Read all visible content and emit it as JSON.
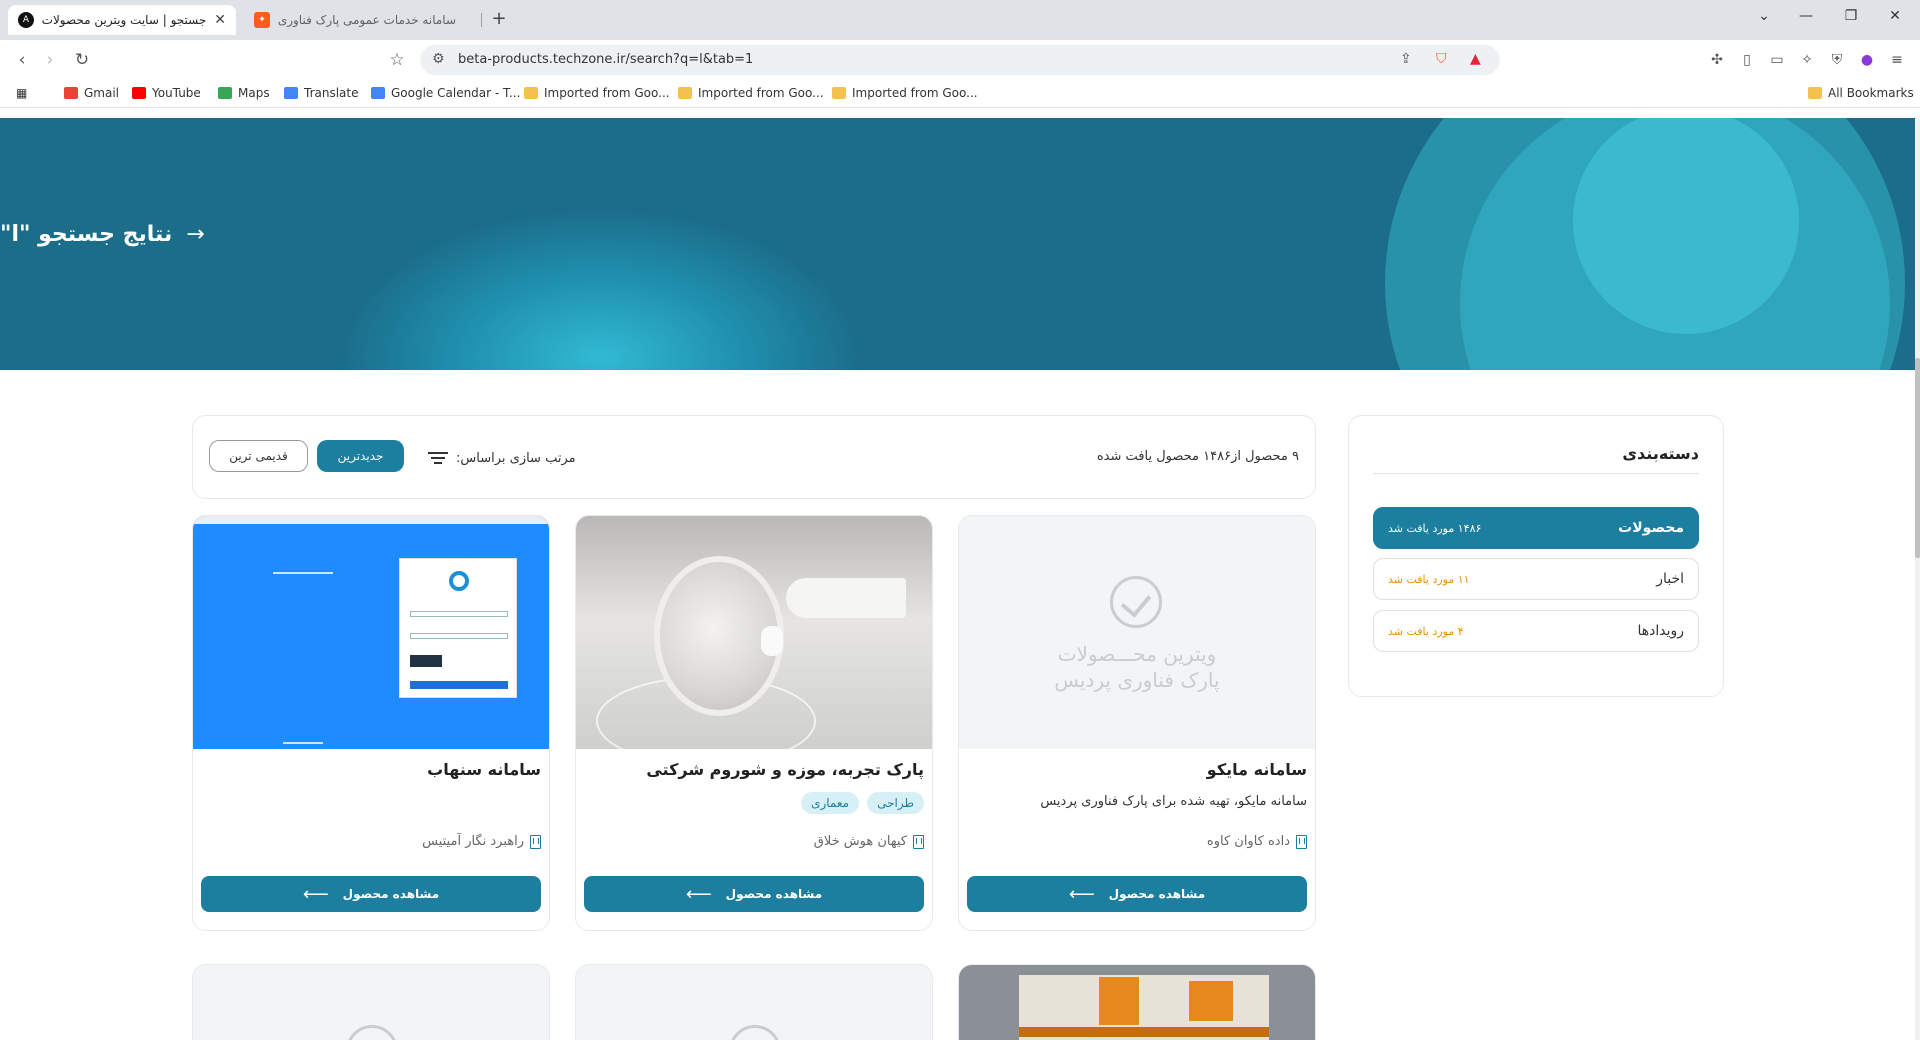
{
  "browser": {
    "tabs": [
      {
        "title": "جستجو | سایت ویترین محصولات",
        "favicon": "A"
      },
      {
        "title": "سامانه خدمات عمومی پارک فناوری پر",
        "favicon": "✦"
      }
    ],
    "url": "beta-products.techzone.ir/search?q=l&tab=1",
    "bookmarks": [
      {
        "label": "Gmail",
        "icon": "gmail-icon",
        "color": "#ea4335"
      },
      {
        "label": "YouTube",
        "icon": "youtube-icon",
        "color": "#ff0000"
      },
      {
        "label": "Maps",
        "icon": "maps-icon",
        "color": "#34a853"
      },
      {
        "label": "Translate",
        "icon": "translate-icon",
        "color": "#4285f4"
      },
      {
        "label": "Google Calendar - T...",
        "icon": "calendar-icon",
        "color": "#4285f4"
      },
      {
        "label": "Imported from Goo...",
        "icon": "folder-icon",
        "color": "#f2c14e"
      },
      {
        "label": "Imported from Goo...",
        "icon": "folder-icon",
        "color": "#f2c14e"
      },
      {
        "label": "Imported from Goo...",
        "icon": "folder-icon",
        "color": "#f2c14e"
      }
    ],
    "all_bookmarks": "All Bookmarks"
  },
  "hero": {
    "title": "نتایج جستجو \"l\"",
    "arrow": "→"
  },
  "categories": {
    "title": "دسته‌بندی",
    "items": [
      {
        "name": "محصولات",
        "count": "۱۴۸۶ مورد یافت شد",
        "active": true
      },
      {
        "name": "اخبار",
        "count": "۱۱ مورد یافت شد",
        "active": false
      },
      {
        "name": "رویدادها",
        "count": "۴ مورد یافت شد",
        "active": false
      }
    ]
  },
  "results": {
    "found_text": "۹ محصول از۱۴۸۶ محصول یافت شده",
    "sort_label": "مرتب سازی براساس:",
    "newest": "جدیدترین",
    "oldest": "قدیمی ترین"
  },
  "products": [
    {
      "title": "سامانه مایکو",
      "description": "سامانه مایکو، تهیه شده برای پارک فناوری پردیس",
      "tags": [],
      "company": "داده کاوان کاوه",
      "image": "placeholder",
      "watermark1": "ویترین محـــصولات",
      "watermark2": "پارک فناوری پردیس"
    },
    {
      "title": "پارک تجربه، موزه و شوروم شرکتی",
      "description": "",
      "tags": [
        "طراحی",
        "معماری"
      ],
      "company": "کیهان هوش خلاق",
      "image": "photo"
    },
    {
      "title": "سامانه سنهاب",
      "description": "",
      "tags": [],
      "company": "راهبرد نگار آمیتیس",
      "image": "screenshot"
    }
  ],
  "view_button": "مشاهده محصول",
  "view_arrow": "⟵"
}
